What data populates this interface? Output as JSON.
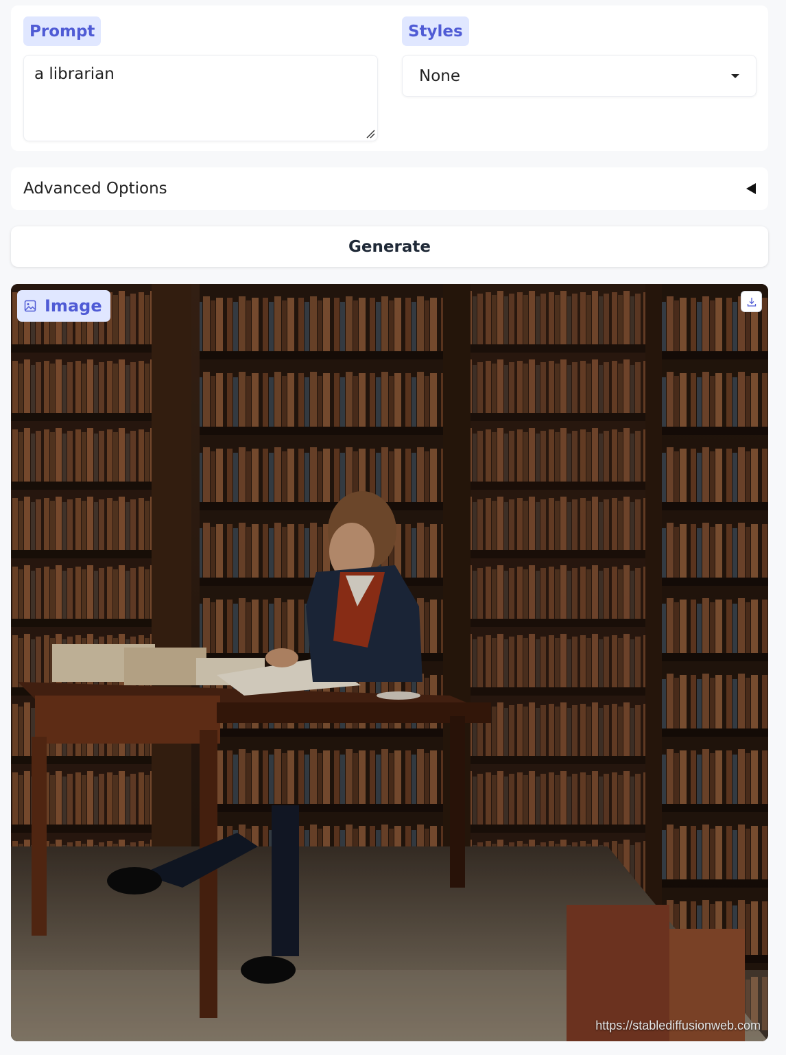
{
  "prompt": {
    "label": "Prompt",
    "value": "a librarian"
  },
  "styles": {
    "label": "Styles",
    "selected": "None"
  },
  "advanced": {
    "label": "Advanced Options"
  },
  "generate": {
    "label": "Generate"
  },
  "image": {
    "label": "Image",
    "watermark": "https://stablediffusionweb.com",
    "subject": "librarian reading at a desk in a library"
  },
  "colors": {
    "accent": "#4f5bd5",
    "chip_bg": "#e0e7ff",
    "page_bg": "#f7f8fa"
  },
  "icons": {
    "image_label": "image-icon",
    "download": "download-icon",
    "dropdown": "caret-down-icon",
    "accordion": "triangle-left-icon"
  }
}
